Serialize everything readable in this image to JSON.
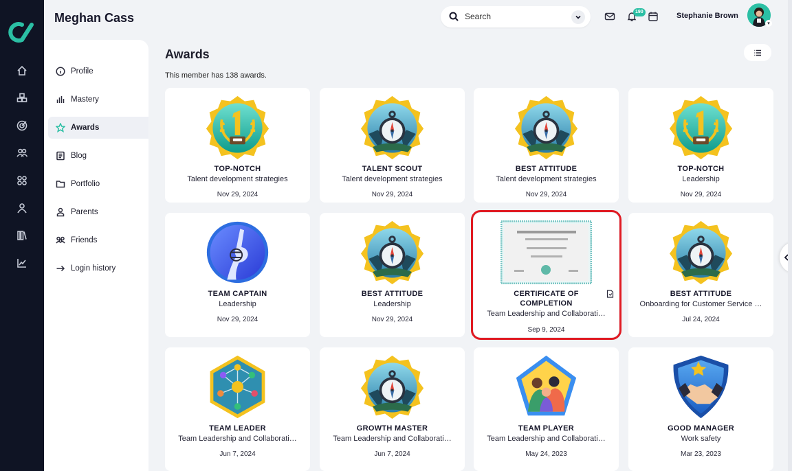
{
  "header": {
    "member_name": "Meghan Cass",
    "search_label": "Search",
    "notification_count": "190",
    "user_name": "Stephanie Brown"
  },
  "profile_nav": [
    {
      "label": "Profile",
      "icon": "info-icon"
    },
    {
      "label": "Mastery",
      "icon": "bar-chart-icon"
    },
    {
      "label": "Awards",
      "icon": "star-icon",
      "active": true
    },
    {
      "label": "Blog",
      "icon": "document-icon"
    },
    {
      "label": "Portfolio",
      "icon": "folder-icon"
    },
    {
      "label": "Parents",
      "icon": "parent-icon"
    },
    {
      "label": "Friends",
      "icon": "friends-icon"
    },
    {
      "label": "Login history",
      "icon": "login-arrow-icon"
    }
  ],
  "page": {
    "title": "Awards",
    "count_text": "This member has 138 awards."
  },
  "awards": [
    {
      "name": "TOP-NOTCH",
      "category": "Talent development strategies",
      "date": "Nov 29, 2024",
      "badge": "trophy-badge"
    },
    {
      "name": "TALENT SCOUT",
      "category": "Talent development strategies",
      "date": "Nov 29, 2024",
      "badge": "compass-badge"
    },
    {
      "name": "BEST ATTITUDE",
      "category": "Talent development strategies",
      "date": "Nov 29, 2024",
      "badge": "compass-badge"
    },
    {
      "name": "TOP-NOTCH",
      "category": "Leadership",
      "date": "Nov 29, 2024",
      "badge": "trophy-badge"
    },
    {
      "name": "TEAM CAPTAIN",
      "category": "Leadership",
      "date": "Nov 29, 2024",
      "badge": "captain-badge"
    },
    {
      "name": "BEST ATTITUDE",
      "category": "Leadership",
      "date": "Nov 29, 2024",
      "badge": "compass-badge"
    },
    {
      "name_line1": "CERTIFICATE OF",
      "name_line2": "COMPLETION",
      "category": "Team Leadership and Collaborati…",
      "date": "Sep 9, 2024",
      "badge": "certificate"
    },
    {
      "name": "BEST ATTITUDE",
      "category": "Onboarding for Customer Service …",
      "date": "Jul 24, 2024",
      "badge": "compass-badge"
    },
    {
      "name": "TEAM LEADER",
      "category": "Team Leadership and Collaborati…",
      "date": "Jun 7, 2024",
      "badge": "network-badge"
    },
    {
      "name": "GROWTH MASTER",
      "category": "Team Leadership and Collaborati…",
      "date": "Jun 7, 2024",
      "badge": "compass-badge"
    },
    {
      "name": "TEAM PLAYER",
      "category": "Team Leadership and Collaborati…",
      "date": "May 24, 2023",
      "badge": "team-badge"
    },
    {
      "name": "GOOD MANAGER",
      "category": "Work safety",
      "date": "Mar 23, 2023",
      "badge": "handshake-badge"
    }
  ],
  "colors": {
    "accent": "#2bbfa4",
    "rail": "#0f1424",
    "highlight": "#e01a22"
  }
}
